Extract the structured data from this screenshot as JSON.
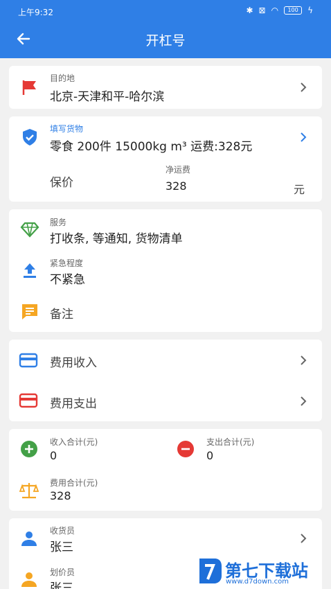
{
  "status": {
    "time": "上午9:32",
    "battery": "100"
  },
  "header": {
    "title": "开杠号"
  },
  "destination": {
    "label": "目的地",
    "value": "北京-天津和平-哈尔滨"
  },
  "goods": {
    "label": "填写货物",
    "value": "零食 200件 15000kg m³ 运费:328元"
  },
  "insurance": {
    "label": "保价",
    "net_label": "净运费",
    "net_value": "328",
    "unit": "元"
  },
  "service": {
    "label": "服务",
    "value": "打收条, 等通知, 货物清单"
  },
  "urgency": {
    "label": "紧急程度",
    "value": "不紧急"
  },
  "remark": {
    "label": "备注"
  },
  "fees": {
    "income": "费用收入",
    "expense": "费用支出"
  },
  "totals": {
    "income_label": "收入合计(元)",
    "income_value": "0",
    "expense_label": "支出合计(元)",
    "expense_value": "0",
    "fee_label": "费用合计(元)",
    "fee_value": "328"
  },
  "people": {
    "receiver_label": "收货员",
    "receiver_value": "张三",
    "pricer_label": "划价员",
    "pricer_value": "张三"
  },
  "watermark": {
    "brand": "第七下载站",
    "url": "www.d7down.com"
  },
  "colors": {
    "primary": "#2f7fe6",
    "red": "#e53935",
    "green": "#43a047",
    "orange": "#f5a623"
  }
}
